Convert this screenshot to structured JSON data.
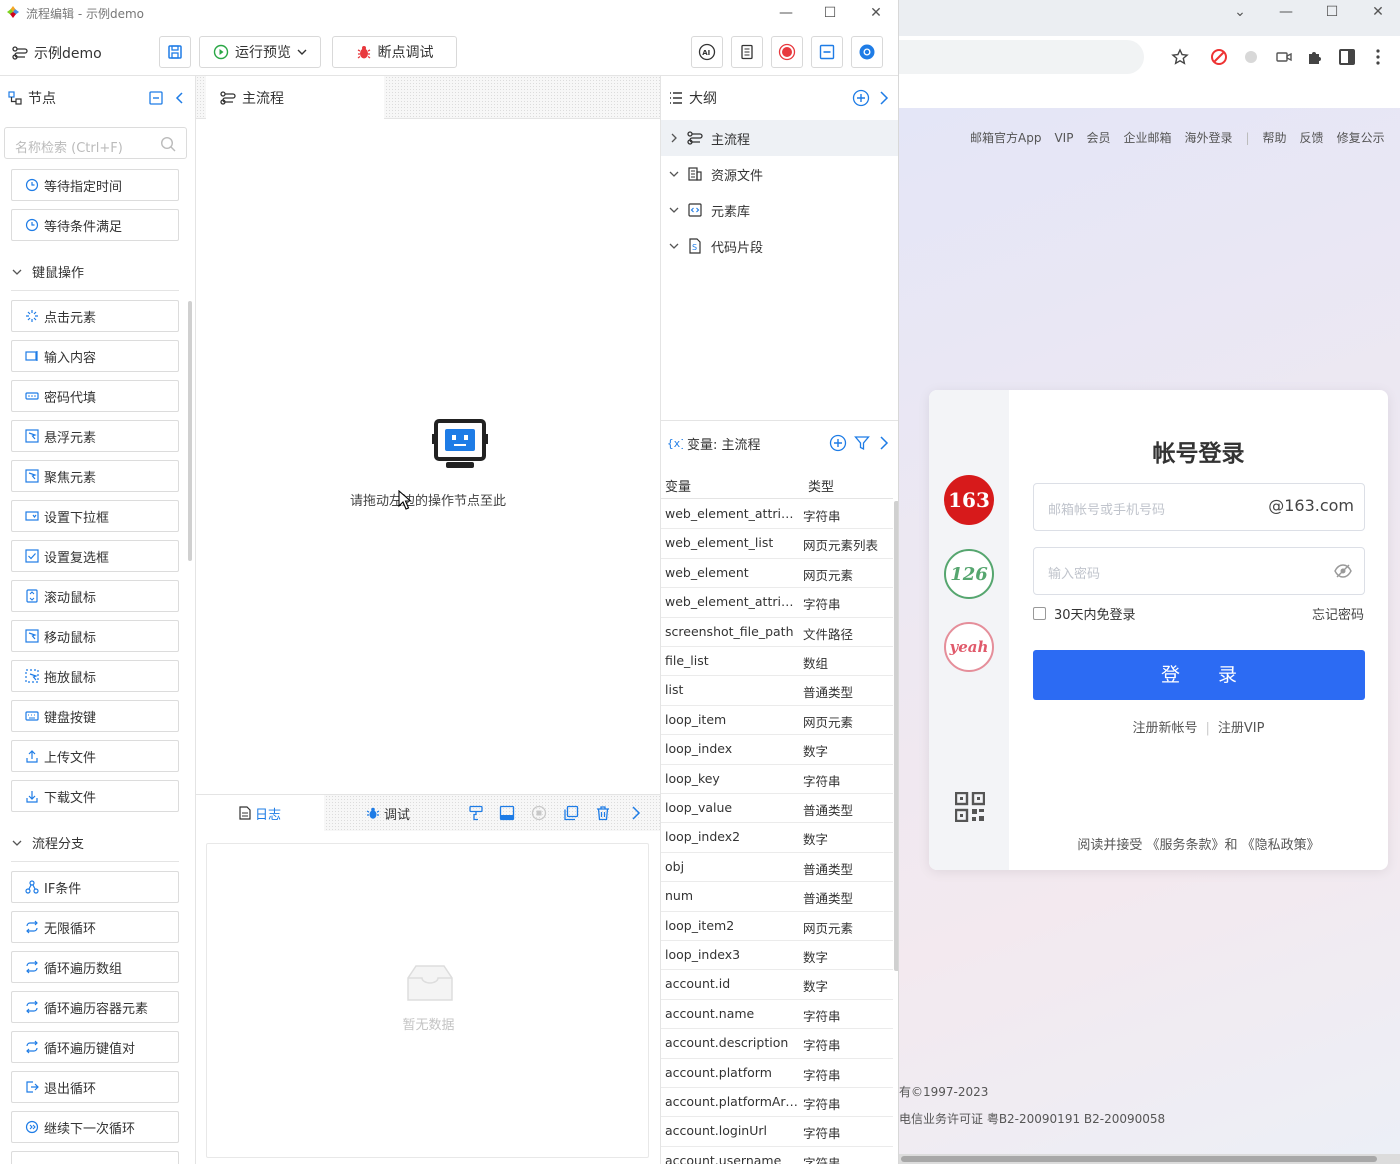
{
  "window": {
    "title": "流程编辑 - 示例demo",
    "project_name": "示例demo"
  },
  "toolbar": {
    "run_preview_label": "运行预览",
    "breakpoint_debug_label": "断点调试"
  },
  "nodes_panel": {
    "title": "节点",
    "search_placeholder": "名称检索 (Ctrl+F)",
    "items_top": [
      "等待指定时间",
      "等待条件满足"
    ],
    "group_mouse_keyboard": "键鼠操作",
    "items_mouse": [
      "点击元素",
      "输入内容",
      "密码代填",
      "悬浮元素",
      "聚焦元素",
      "设置下拉框",
      "设置复选框",
      "滚动鼠标",
      "移动鼠标",
      "拖放鼠标",
      "键盘按键",
      "上传文件",
      "下载文件"
    ],
    "group_flow_branch": "流程分支",
    "items_flow": [
      "IF条件",
      "无限循环",
      "循环遍历数组",
      "循环遍历容器元素",
      "循环遍历键值对",
      "退出循环",
      "继续下一次循环"
    ]
  },
  "canvas": {
    "tab_label": "主流程",
    "empty_hint": "请拖动左边的操作节点至此"
  },
  "log_panel": {
    "log_tab": "日志",
    "debug_tab": "调试",
    "empty_text": "暂无数据"
  },
  "outline": {
    "title": "大纲",
    "items": [
      {
        "label": "主流程",
        "expanded": false
      },
      {
        "label": "资源文件",
        "expanded": true
      },
      {
        "label": "元素库",
        "expanded": true
      },
      {
        "label": "代码片段",
        "expanded": true
      }
    ]
  },
  "variables": {
    "title": "变量: 主流程",
    "col_name": "变量",
    "col_type": "类型",
    "rows": [
      {
        "name": "web_element_attribute",
        "type": "字符串"
      },
      {
        "name": "web_element_list",
        "type": "网页元素列表"
      },
      {
        "name": "web_element",
        "type": "网页元素"
      },
      {
        "name": "web_element_attribu...",
        "type": "字符串"
      },
      {
        "name": "screenshot_file_path",
        "type": "文件路径"
      },
      {
        "name": "file_list",
        "type": "数组"
      },
      {
        "name": "list",
        "type": "普通类型"
      },
      {
        "name": "loop_item",
        "type": "网页元素"
      },
      {
        "name": "loop_index",
        "type": "数字"
      },
      {
        "name": "loop_key",
        "type": "字符串"
      },
      {
        "name": "loop_value",
        "type": "普通类型"
      },
      {
        "name": "loop_index2",
        "type": "数字"
      },
      {
        "name": "obj",
        "type": "普通类型"
      },
      {
        "name": "num",
        "type": "普通类型"
      },
      {
        "name": "loop_item2",
        "type": "网页元素"
      },
      {
        "name": "loop_index3",
        "type": "数字"
      },
      {
        "name": "account.id",
        "type": "数字"
      },
      {
        "name": "account.name",
        "type": "字符串"
      },
      {
        "name": "account.description",
        "type": "字符串"
      },
      {
        "name": "account.platform",
        "type": "字符串"
      },
      {
        "name": "account.platformArea",
        "type": "字符串"
      },
      {
        "name": "account.loginUrl",
        "type": "字符串"
      },
      {
        "name": "account.username",
        "type": "字符串"
      }
    ]
  },
  "browser": {
    "top_links": [
      "邮箱官方App",
      "VIP",
      "会员",
      "企业邮箱",
      "海外登录",
      "帮助",
      "反馈",
      "修复公示"
    ],
    "footer_line1": "有©1997-2023",
    "footer_line2": "电信业务许可证 粤B2-20090191  B2-20090058"
  },
  "login": {
    "title": "帐号登录",
    "brand_163": "163",
    "brand_126": "126",
    "brand_yeah": "yeah",
    "account_placeholder": "邮箱帐号或手机号码",
    "account_suffix": "@163.com",
    "password_placeholder": "输入密码",
    "remember_label": "30天内免登录",
    "forgot_label": "忘记密码",
    "login_button": "登 录",
    "register_label": "注册新帐号",
    "register_vip_label": "注册VIP",
    "agreement": "阅读并接受 《服务条款》和 《隐私政策》"
  },
  "colors": {
    "accent_blue": "#1e7ce6",
    "login_button": "#2c6bf3",
    "brand_163": "#d71a1b",
    "record_red": "#e8383d"
  }
}
